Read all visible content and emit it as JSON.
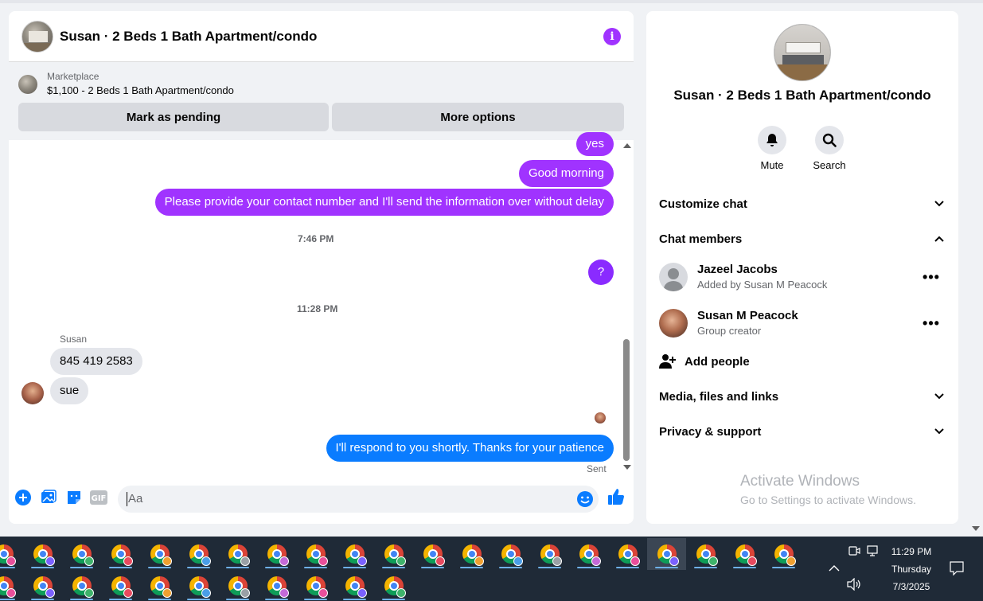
{
  "chat": {
    "title": "Susan · 2 Beds 1 Bath Apartment/condo",
    "marketplace_label": "Marketplace",
    "listing": "$1,100 - 2 Beds 1 Bath Apartment/condo",
    "mark_pending": "Mark as pending",
    "more_options": "More options",
    "messages": {
      "m1": "yes",
      "m2": "Good morning",
      "m3": "Please provide your contact number and I'll send the information over without delay",
      "ts1": "7:46 PM",
      "m4": "?",
      "ts2": "11:28 PM",
      "sender": "Susan",
      "m5": "845 419 2583",
      "m6": "sue",
      "m7": "I'll respond to you shortly. Thanks for your patience",
      "sent": "Sent"
    },
    "composer_placeholder": "Aa"
  },
  "info": {
    "name": "Susan · 2 Beds 1 Bath Apartment/condo",
    "mute": "Mute",
    "search": "Search",
    "customize": "Customize chat",
    "members_heading": "Chat members",
    "members": [
      {
        "name": "Jazeel Jacobs",
        "sub": "Added by Susan M Peacock"
      },
      {
        "name": "Susan M Peacock",
        "sub": "Group creator"
      }
    ],
    "add_people": "Add people",
    "media": "Media, files and links",
    "privacy": "Privacy & support",
    "watermark1": "Activate Windows",
    "watermark2": "Go to Settings to activate Windows."
  },
  "taskbar": {
    "time": "11:29 PM",
    "day": "Thursday",
    "date": "7/3/2025"
  },
  "colors": {
    "accent_purple": "#a033ff",
    "message_blue": "#0a7cff",
    "taskbar": "#1f2a37"
  }
}
